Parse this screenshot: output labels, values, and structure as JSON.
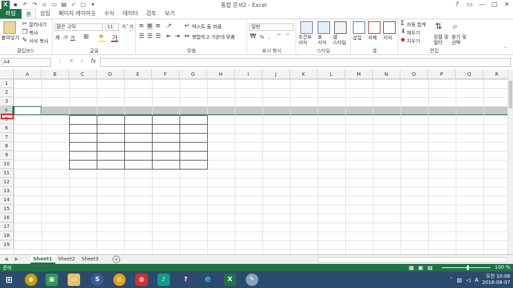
{
  "window": {
    "title": "통합 문서2 - Excel",
    "controls": [
      "?",
      "▭",
      "—",
      "□",
      "✕"
    ]
  },
  "ribbon_tabs": [
    "파일",
    "홈",
    "삽입",
    "페이지 레이아웃",
    "수식",
    "데이터",
    "검토",
    "보기"
  ],
  "active_tab": "홈",
  "ribbon": {
    "clipboard": {
      "label": "클립보드",
      "paste": "붙여넣기",
      "cut": "잘라내기",
      "copy": "복사",
      "format_painter": "서식 복사"
    },
    "font": {
      "label": "글꼴",
      "font_name": "맑은 고딕",
      "font_size": "11",
      "bold": "가",
      "italic": "가",
      "underline": "가"
    },
    "alignment": {
      "label": "맞춤",
      "wrap_text": "텍스트 줄 바꿈",
      "merge_center": "병합하고 가운데 맞춤"
    },
    "number": {
      "label": "표시 형식",
      "format": "일반",
      "percent": "%",
      "comma": ","
    },
    "styles": {
      "label": "스타일",
      "conditional": "조건부\n서식",
      "table": "표\n서식",
      "cell_style": "셀\n스타일"
    },
    "cells": {
      "label": "셀",
      "insert": "삽입",
      "delete": "삭제",
      "format": "서식"
    },
    "editing": {
      "label": "편집",
      "autosum": "자동 합계",
      "fill": "채우기",
      "clear": "지우기",
      "sort_filter": "정렬 및\n필터",
      "find_select": "찾기 및\n선택"
    }
  },
  "formula_bar": {
    "name_box": "A4",
    "fx": "fx",
    "formula": ""
  },
  "columns": [
    "A",
    "B",
    "C",
    "D",
    "E",
    "F",
    "G",
    "H",
    "I",
    "J",
    "K",
    "L",
    "M",
    "N",
    "O",
    "P",
    "Q",
    "R"
  ],
  "rows": [
    "1",
    "2",
    "3",
    "4",
    "5",
    "6",
    "7",
    "8",
    "9",
    "10",
    "11",
    "12",
    "13",
    "14",
    "15",
    "16",
    "17",
    "18",
    "19"
  ],
  "selected_row": "4",
  "sheets": [
    "Sheet1",
    "Sheet2",
    "Sheet3"
  ],
  "active_sheet": "Sheet1",
  "status": {
    "ready": "준비",
    "zoom": "100 %"
  },
  "taskbar": {
    "apps": [
      "cortana",
      "store",
      "explorer",
      "browser1",
      "chrome",
      "app-red",
      "music",
      "help",
      "ie",
      "excel",
      "paint"
    ],
    "time": "오전 10:08",
    "date": "2016-08-07"
  },
  "colors": {
    "accent": "#217346",
    "taskbar": "#2b4b6e",
    "highlight": "#e02020"
  }
}
